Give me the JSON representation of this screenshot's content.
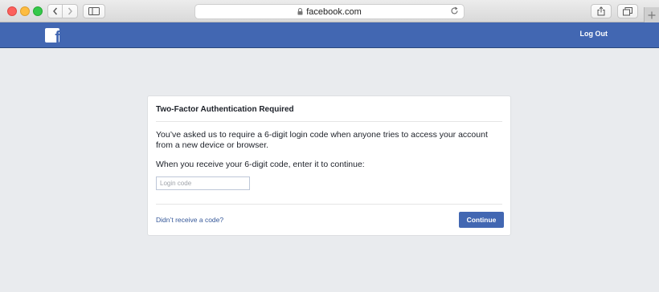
{
  "browser": {
    "url": "facebook.com",
    "icons": {
      "back": "chevron-left-icon",
      "forward": "chevron-right-icon",
      "sidebar": "sidebar-icon",
      "lock": "lock-icon",
      "reload": "reload-icon",
      "share": "share-icon",
      "tabs": "tabs-icon",
      "new_tab": "plus-icon"
    }
  },
  "header": {
    "logo_letter": "f",
    "logout_label": "Log Out",
    "color": "#4267b2"
  },
  "dialog": {
    "title": "Two-Factor Authentication Required",
    "message": "You’ve asked us to require a 6-digit login code when anyone tries to access your account from a new device or browser.",
    "instruction": "When you receive your 6-digit code, enter it to continue:",
    "input_placeholder": "Login code",
    "input_value": "",
    "resend_link": "Didn’t receive a code?",
    "continue_label": "Continue"
  }
}
